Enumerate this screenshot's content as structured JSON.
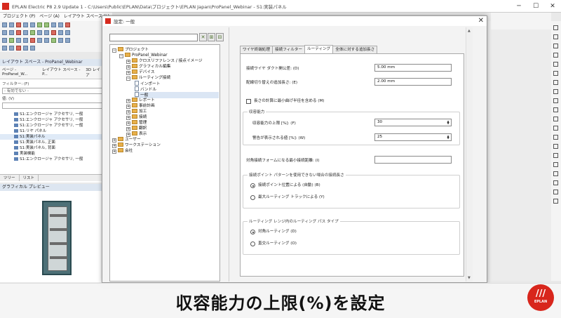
{
  "app": {
    "title": "EPLAN Electric P8 2.9 Update 1 - C:\\Users\\Public\\EPLAN\\Data\\プロジェクト\\EPLAN Japan\\ProPanel_Webinar - S1:実装パネル",
    "menu": [
      "プロジェクト (P)",
      "ページ (A)",
      "レイアウト スペース (L)"
    ]
  },
  "left_panel": {
    "header": "レイアウト スペース - ProPanel_Webinar",
    "tabs": [
      "ページ - ProPanel_W...",
      "レイアウト スペース - P...",
      "3D レイア"
    ],
    "filter_label": "フィルター: (F)",
    "filter_value": "- 有効でない -",
    "value_label": "値: (V)",
    "items": [
      "S1:エンクロージャ アクセサリ, 一般",
      "S1:エンクロージャ アクセサリ, 一般",
      "S1:エンクロージャ アクセサリ, 一般",
      "S1:リヤ パネル",
      "S1:実装パネル",
      "S1:実装パネル, 正面",
      "S1:実装パネル, 背面",
      "実装機能",
      "S1:エンクロージャ アクセサリ, 一般"
    ],
    "bottom_tabs": [
      "ツリー",
      "リスト"
    ],
    "preview_header": "グラフィカル プレビュー"
  },
  "dialog": {
    "title": "設定: 一般",
    "close": "✕",
    "tree": {
      "root": "プロジェクト",
      "project": "ProPanel_Webinar",
      "children": [
        "クロスリファレンス / 接点イメージ",
        "グラフィカル編集",
        "デバイス",
        "ルーティング接続"
      ],
      "routing_children": [
        "インポート",
        "バンドル",
        "一般"
      ],
      "more": [
        "レポート",
        "事前計画",
        "加工",
        "接続",
        "管理",
        "翻訳",
        "表示"
      ],
      "roots": [
        "ユーザー",
        "ワークステーション",
        "会社"
      ]
    },
    "tabs": [
      "ワイヤ終端処理",
      "接続フィルター",
      "ルーティング",
      "全体に対する追加長さ"
    ],
    "fields": {
      "duct_label": "接続ワイヤ ダクト開公差: (D)",
      "duct_value": "5.00 mm",
      "extra_label": "配線切り替えの追加長さ: (E)",
      "extra_value": "2.00 mm",
      "min_bend_label": "長さの計算に最小曲げ半径を含める (M)",
      "capacity_group": "収容能力",
      "capacity_upper_label": "収容能力の上限 [%]: (F)",
      "capacity_upper_value": "30",
      "warning_label": "警告が表示される値 [%]: (W)",
      "warning_value": "25",
      "form_label": "対角接続フォームになる最小接続距離: (I)",
      "form_value": "",
      "pattern_group": "接続ポイント パターンを使用できない場合の接続長さ",
      "pattern_opt1": "接続ポイント位置による (自動) (B)",
      "pattern_opt2": "最大ルーティング トラックによる (Y)",
      "path_group": "ルーティング レンジ内のルーティング パス タイプ",
      "path_opt1": "対角ルーティング (D)",
      "path_opt2": "直交ルーティング (O)"
    }
  },
  "caption": {
    "text": "収容能力の上限(%)を設定",
    "badge_main": "///",
    "badge_sub": "EPLAN"
  },
  "colors": {
    "brand_red": "#d8261c",
    "folder": "#e8b04a",
    "selection": "#dbe6f4"
  }
}
